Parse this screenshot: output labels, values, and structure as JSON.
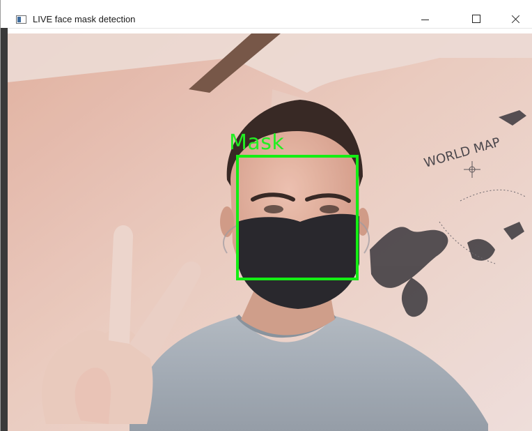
{
  "window": {
    "title": "LIVE face mask detection",
    "app_icon": "opencv-window-icon",
    "controls": {
      "minimize_icon": "minimize-icon",
      "maximize_icon": "maximize-icon",
      "close_icon": "close-icon"
    }
  },
  "video": {
    "scene": "webcam-frame",
    "wall_text": "WORLD MAP",
    "detection": {
      "label": "Mask",
      "color": "#14ee14"
    }
  }
}
